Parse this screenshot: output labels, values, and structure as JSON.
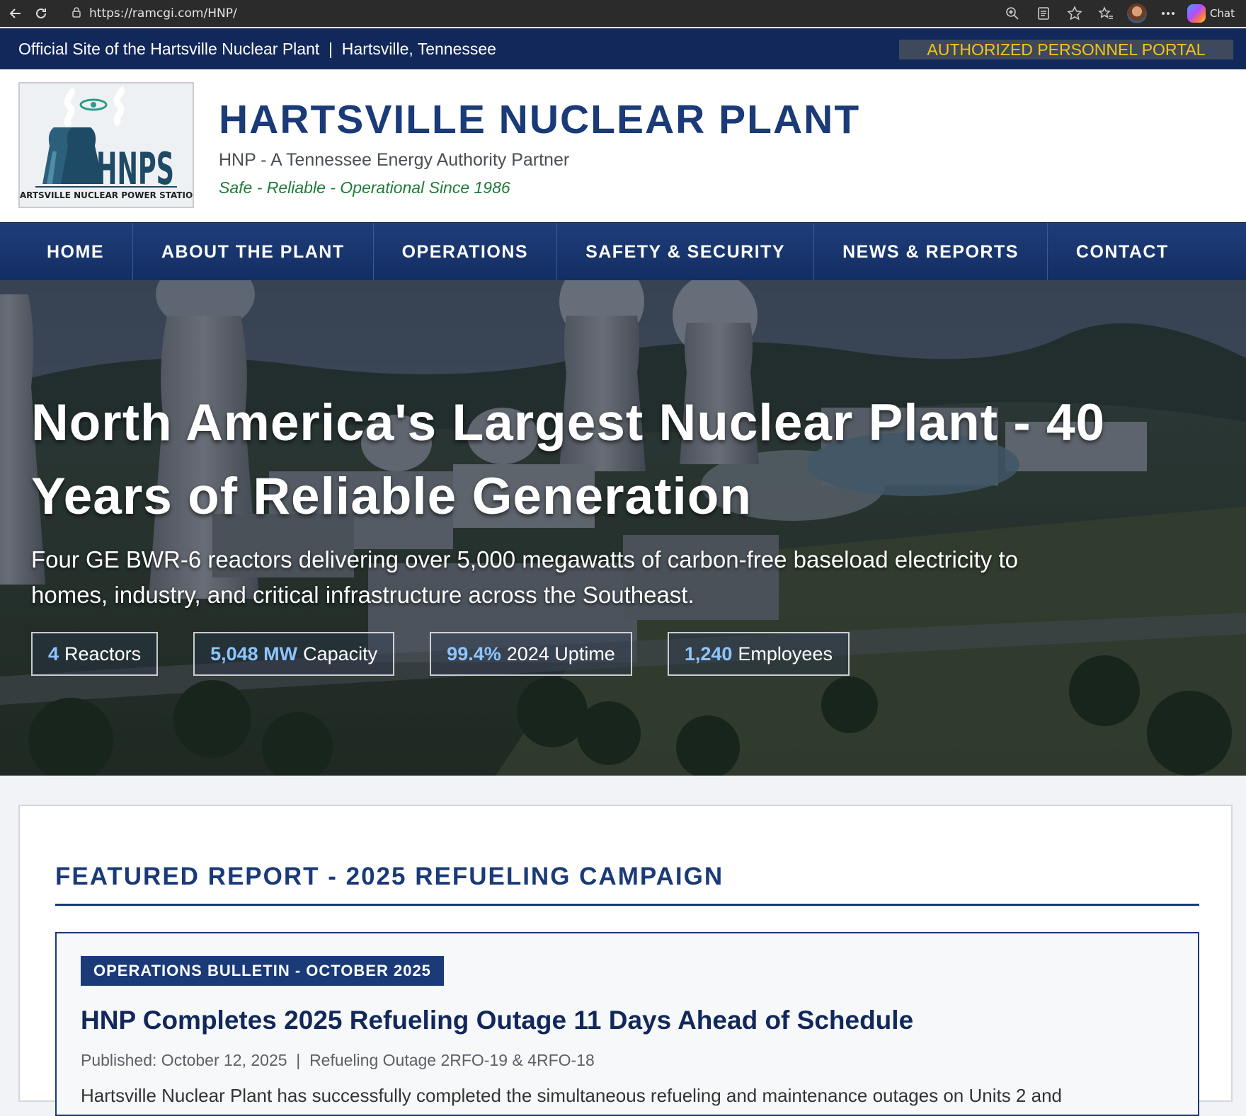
{
  "browser": {
    "url": "https://ramcgi.com/HNP/",
    "chat_label": "Chat"
  },
  "topstrip": {
    "info": "Official Site of the Hartsville Nuclear Plant  |  Hartsville, Tennessee",
    "portal": "AUTHORIZED PERSONNEL PORTAL"
  },
  "header": {
    "logo_big": "HNPS",
    "logo_small": "HARTSVILLE NUCLEAR POWER STATION",
    "title": "HARTSVILLE NUCLEAR PLANT",
    "subtitle": "HNP - A Tennessee Energy Authority Partner",
    "tagline": "Safe - Reliable - Operational Since 1986"
  },
  "nav": {
    "items": [
      {
        "label": "HOME"
      },
      {
        "label": "ABOUT THE PLANT"
      },
      {
        "label": "OPERATIONS"
      },
      {
        "label": "SAFETY & SECURITY"
      },
      {
        "label": "NEWS & REPORTS"
      },
      {
        "label": "CONTACT"
      }
    ]
  },
  "hero": {
    "title": "North America's Largest Nuclear Plant - 40 Years of Reliable Generation",
    "description": "Four GE BWR-6 reactors delivering over 5,000 megawatts of carbon-free baseload electricity to homes, industry, and critical infrastructure across the Southeast.",
    "stats": [
      {
        "value": "4",
        "label": "Reactors"
      },
      {
        "value": "5,048 MW",
        "label": "Capacity"
      },
      {
        "value": "99.4%",
        "label": "2024 Uptime"
      },
      {
        "value": "1,240",
        "label": "Employees"
      }
    ]
  },
  "featured": {
    "section_title": "FEATURED REPORT - 2025 REFUELING CAMPAIGN",
    "badge": "OPERATIONS BULLETIN - OCTOBER 2025",
    "headline": "HNP Completes 2025 Refueling Outage 11 Days Ahead of Schedule",
    "meta": "Published: October 12, 2025  |  Refueling Outage 2RFO-19 & 4RFO-18",
    "body": "Hartsville Nuclear Plant has successfully completed the simultaneous refueling and maintenance outages on Units 2 and"
  },
  "colors": {
    "navy": "#12285a",
    "brand_blue": "#1a3a78",
    "portal_gold": "#f5c518",
    "tagline_green": "#1f7a3a",
    "stat_accent": "#8ec5ff"
  }
}
